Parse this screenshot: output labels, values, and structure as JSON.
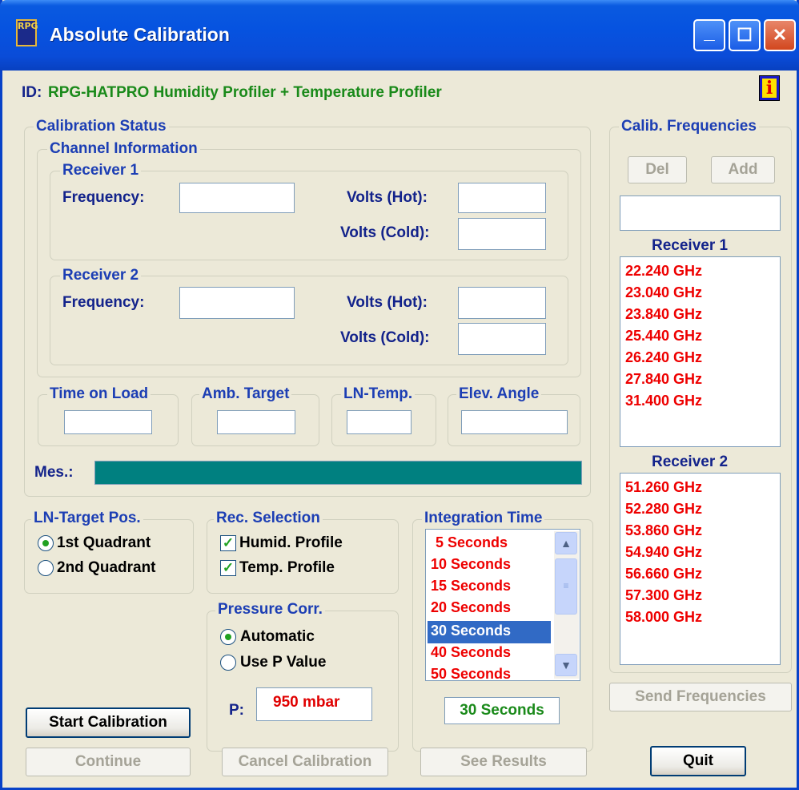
{
  "window": {
    "title": "Absolute Calibration",
    "icon_name": "rpg-app-icon",
    "icon_text": "RPG",
    "minimize_glyph": "_",
    "maximize_glyph": "☐",
    "close_glyph": "✕"
  },
  "id_line": {
    "label": "ID:",
    "value": "RPG-HATPRO Humidity Profiler + Temperature Profiler",
    "info_icon": "i"
  },
  "calibration_status": {
    "title": "Calibration Status",
    "channel_information": {
      "title": "Channel Information",
      "receiver1": {
        "title": "Receiver 1",
        "frequency_label": "Frequency:",
        "frequency_value": "",
        "volts_hot_label": "Volts (Hot):",
        "volts_hot_value": "",
        "volts_cold_label": "Volts (Cold):",
        "volts_cold_value": ""
      },
      "receiver2": {
        "title": "Receiver 2",
        "frequency_label": "Frequency:",
        "frequency_value": "",
        "volts_hot_label": "Volts (Hot):",
        "volts_hot_value": "",
        "volts_cold_label": "Volts (Cold):",
        "volts_cold_value": ""
      }
    },
    "time_on_load": {
      "title": "Time on Load",
      "value": ""
    },
    "amb_target": {
      "title": "Amb. Target",
      "value": ""
    },
    "ln_temp": {
      "title": "LN-Temp.",
      "value": ""
    },
    "elev_angle": {
      "title": "Elev. Angle",
      "value": ""
    },
    "mes_label": "Mes.:",
    "mes_color": "#008080"
  },
  "ln_target_pos": {
    "title": "LN-Target Pos.",
    "options": [
      {
        "label": "1st Quadrant",
        "selected": true
      },
      {
        "label": "2nd Quadrant",
        "selected": false
      }
    ]
  },
  "rec_selection": {
    "title": "Rec. Selection",
    "options": [
      {
        "label": "Humid. Profile",
        "checked": true
      },
      {
        "label": "Temp. Profile",
        "checked": true
      }
    ]
  },
  "pressure_corr": {
    "title": "Pressure Corr.",
    "options": [
      {
        "label": "Automatic",
        "selected": true
      },
      {
        "label": "Use P Value",
        "selected": false
      }
    ],
    "p_label": "P:",
    "p_value": "950 mbar"
  },
  "integration_time": {
    "title": "Integration Time",
    "items": [
      "5 Seconds",
      "10 Seconds",
      "15 Seconds",
      "20 Seconds",
      "30 Seconds",
      "40 Seconds",
      "50 Seconds"
    ],
    "selected_index": 4,
    "selected_value": "30 Seconds"
  },
  "calib_frequencies": {
    "title": "Calib. Frequencies",
    "del_label": "Del",
    "add_label": "Add",
    "entry_value": "",
    "receiver1_label": "Receiver 1",
    "receiver1_list": [
      "22.240 GHz",
      "23.040 GHz",
      "23.840 GHz",
      "25.440 GHz",
      "26.240 GHz",
      "27.840 GHz",
      "31.400 GHz"
    ],
    "receiver2_label": "Receiver 2",
    "receiver2_list": [
      "51.260 GHz",
      "52.280 GHz",
      "53.860 GHz",
      "54.940 GHz",
      "56.660 GHz",
      "57.300 GHz",
      "58.000 GHz"
    ],
    "send_label": "Send Frequencies"
  },
  "buttons": {
    "start_calibration": "Start Calibration",
    "continue": "Continue",
    "cancel_calibration": "Cancel Calibration",
    "see_results": "See Results",
    "quit": "Quit"
  },
  "colors": {
    "title_blue": "#0a4cd8",
    "id_green": "#1a8a1a",
    "list_red": "#e00000",
    "selection_blue": "#316ac5"
  }
}
